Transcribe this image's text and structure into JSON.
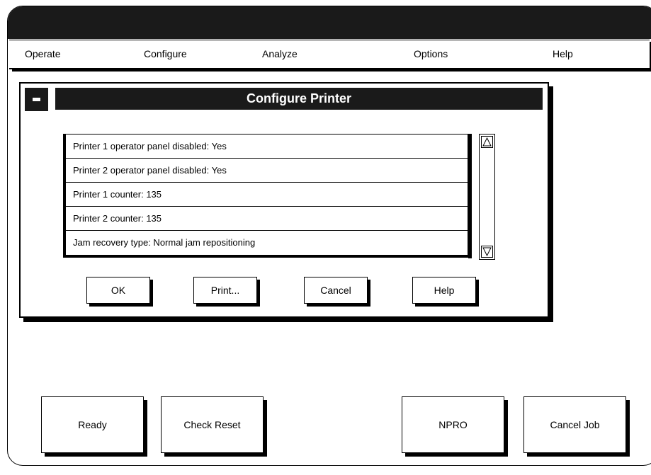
{
  "menubar": {
    "items": [
      {
        "label": "Operate"
      },
      {
        "label": "Configure"
      },
      {
        "label": "Analyze"
      },
      {
        "label": "Options"
      },
      {
        "label": "Help"
      }
    ]
  },
  "dialog": {
    "title": "Configure Printer",
    "list": [
      {
        "text": "Printer 1 operator panel disabled: Yes"
      },
      {
        "text": "Printer 2 operator panel disabled: Yes"
      },
      {
        "text": "Printer 1 counter: 135"
      },
      {
        "text": "Printer 2 counter: 135"
      },
      {
        "text": "Jam recovery type: Normal jam repositioning"
      }
    ],
    "buttons": {
      "ok": "OK",
      "print": "Print...",
      "cancel": "Cancel",
      "help": "Help"
    }
  },
  "bottom_buttons": {
    "ready": "Ready",
    "check_reset": "Check Reset",
    "npro": "NPRO",
    "cancel_job": "Cancel Job"
  }
}
